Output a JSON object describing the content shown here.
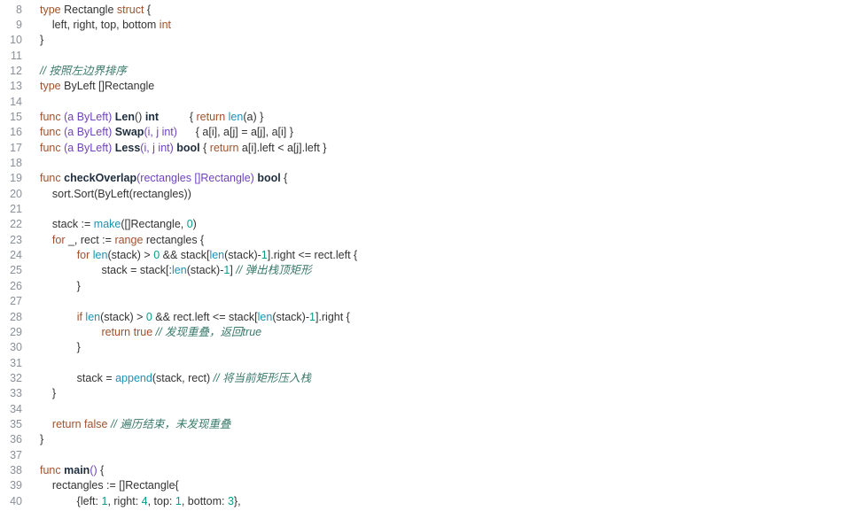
{
  "editor": {
    "lines": [
      {
        "n": "8",
        "tokens": [
          [
            "kw",
            "type"
          ],
          [
            "p",
            " Rectangle "
          ],
          [
            "kw",
            "struct"
          ],
          [
            "p",
            " {"
          ]
        ]
      },
      {
        "n": "9",
        "tokens": [
          [
            "p",
            "    left, right, top, bottom "
          ],
          [
            "kw",
            "int"
          ]
        ]
      },
      {
        "n": "10",
        "tokens": [
          [
            "p",
            "}"
          ]
        ]
      },
      {
        "n": "11",
        "tokens": []
      },
      {
        "n": "12",
        "tokens": [
          [
            "c",
            "// 按照左边界排序"
          ]
        ]
      },
      {
        "n": "13",
        "tokens": [
          [
            "kw",
            "type"
          ],
          [
            "p",
            " ByLeft []Rectangle"
          ]
        ]
      },
      {
        "n": "14",
        "tokens": []
      },
      {
        "n": "15",
        "tokens": [
          [
            "kw",
            "func"
          ],
          [
            "pa",
            " (a ByLeft) "
          ],
          [
            "f",
            "Len"
          ],
          [
            "p",
            "() "
          ],
          [
            "f",
            "int"
          ],
          [
            "p",
            "          { "
          ],
          [
            "kw",
            "return"
          ],
          [
            "p",
            " "
          ],
          [
            "b",
            "len"
          ],
          [
            "p",
            "(a) }"
          ]
        ]
      },
      {
        "n": "16",
        "tokens": [
          [
            "kw",
            "func"
          ],
          [
            "pa",
            " (a ByLeft) "
          ],
          [
            "f",
            "Swap"
          ],
          [
            "pa",
            "(i, j int)"
          ],
          [
            "p",
            "      { a[i], a[j] = a[j], a[i] }"
          ]
        ]
      },
      {
        "n": "17",
        "tokens": [
          [
            "kw",
            "func"
          ],
          [
            "pa",
            " (a ByLeft) "
          ],
          [
            "f",
            "Less"
          ],
          [
            "pa",
            "(i, j int)"
          ],
          [
            "p",
            " "
          ],
          [
            "f",
            "bool"
          ],
          [
            "p",
            " { "
          ],
          [
            "kw",
            "return"
          ],
          [
            "p",
            " a[i].left < a[j].left }"
          ]
        ]
      },
      {
        "n": "18",
        "tokens": []
      },
      {
        "n": "19",
        "tokens": [
          [
            "kw",
            "func"
          ],
          [
            "p",
            " "
          ],
          [
            "f",
            "checkOverlap"
          ],
          [
            "pa",
            "(rectangles []Rectangle)"
          ],
          [
            "p",
            " "
          ],
          [
            "f",
            "bool"
          ],
          [
            "p",
            " {"
          ]
        ]
      },
      {
        "n": "20",
        "tokens": [
          [
            "p",
            "    sort.Sort(ByLeft(rectangles))"
          ]
        ]
      },
      {
        "n": "21",
        "tokens": []
      },
      {
        "n": "22",
        "tokens": [
          [
            "p",
            "    stack := "
          ],
          [
            "b",
            "make"
          ],
          [
            "p",
            "([]Rectangle, "
          ],
          [
            "n",
            "0"
          ],
          [
            "p",
            ")"
          ]
        ]
      },
      {
        "n": "23",
        "tokens": [
          [
            "p",
            "    "
          ],
          [
            "kw",
            "for"
          ],
          [
            "p",
            " _, rect := "
          ],
          [
            "kw",
            "range"
          ],
          [
            "p",
            " rectangles {"
          ]
        ]
      },
      {
        "n": "24",
        "tokens": [
          [
            "p",
            "            "
          ],
          [
            "kw",
            "for"
          ],
          [
            "p",
            " "
          ],
          [
            "b",
            "len"
          ],
          [
            "p",
            "(stack) > "
          ],
          [
            "n",
            "0"
          ],
          [
            "p",
            " && stack["
          ],
          [
            "b",
            "len"
          ],
          [
            "p",
            "(stack)-"
          ],
          [
            "n",
            "1"
          ],
          [
            "p",
            "].right <= rect.left {"
          ]
        ]
      },
      {
        "n": "25",
        "tokens": [
          [
            "p",
            "                    stack = stack[:"
          ],
          [
            "b",
            "len"
          ],
          [
            "p",
            "(stack)-"
          ],
          [
            "n",
            "1"
          ],
          [
            "p",
            "] "
          ],
          [
            "c",
            "// 弹出栈顶矩形"
          ]
        ]
      },
      {
        "n": "26",
        "tokens": [
          [
            "p",
            "            }"
          ]
        ]
      },
      {
        "n": "27",
        "tokens": []
      },
      {
        "n": "28",
        "tokens": [
          [
            "p",
            "            "
          ],
          [
            "kw",
            "if"
          ],
          [
            "p",
            " "
          ],
          [
            "b",
            "len"
          ],
          [
            "p",
            "(stack) > "
          ],
          [
            "n",
            "0"
          ],
          [
            "p",
            " && rect.left <= stack["
          ],
          [
            "b",
            "len"
          ],
          [
            "p",
            "(stack)-"
          ],
          [
            "n",
            "1"
          ],
          [
            "p",
            "].right {"
          ]
        ]
      },
      {
        "n": "29",
        "tokens": [
          [
            "p",
            "                    "
          ],
          [
            "kw",
            "return"
          ],
          [
            "p",
            " "
          ],
          [
            "kw",
            "true"
          ],
          [
            "p",
            " "
          ],
          [
            "c",
            "// 发现重叠，返回true"
          ]
        ]
      },
      {
        "n": "30",
        "tokens": [
          [
            "p",
            "            }"
          ]
        ]
      },
      {
        "n": "31",
        "tokens": []
      },
      {
        "n": "32",
        "tokens": [
          [
            "p",
            "            stack = "
          ],
          [
            "b",
            "append"
          ],
          [
            "p",
            "(stack, rect) "
          ],
          [
            "c",
            "// 将当前矩形压入栈"
          ]
        ]
      },
      {
        "n": "33",
        "tokens": [
          [
            "p",
            "    }"
          ]
        ]
      },
      {
        "n": "34",
        "tokens": []
      },
      {
        "n": "35",
        "tokens": [
          [
            "p",
            "    "
          ],
          [
            "kw",
            "return"
          ],
          [
            "p",
            " "
          ],
          [
            "kw",
            "false"
          ],
          [
            "p",
            " "
          ],
          [
            "c",
            "// 遍历结束，未发现重叠"
          ]
        ]
      },
      {
        "n": "36",
        "tokens": [
          [
            "p",
            "}"
          ]
        ]
      },
      {
        "n": "37",
        "tokens": []
      },
      {
        "n": "38",
        "tokens": [
          [
            "kw",
            "func"
          ],
          [
            "p",
            " "
          ],
          [
            "f",
            "main"
          ],
          [
            "pa",
            "()"
          ],
          [
            "p",
            " {"
          ]
        ]
      },
      {
        "n": "39",
        "tokens": [
          [
            "p",
            "    rectangles := []Rectangle{"
          ]
        ]
      },
      {
        "n": "40",
        "tokens": [
          [
            "p",
            "            {left: "
          ],
          [
            "n",
            "1"
          ],
          [
            "p",
            ", right: "
          ],
          [
            "n",
            "4"
          ],
          [
            "p",
            ", top: "
          ],
          [
            "n",
            "1"
          ],
          [
            "p",
            ", bottom: "
          ],
          [
            "n",
            "3"
          ],
          [
            "p",
            "},"
          ]
        ]
      }
    ]
  },
  "colors": {
    "background": "#ffffff",
    "line_number": "#8a8f98",
    "keyword": "#a0522d",
    "number": "#0a9a8a",
    "builtin": "#1e90b4",
    "param": "#6f42c1",
    "comment": "#3a7a6a",
    "plain": "#333333"
  }
}
